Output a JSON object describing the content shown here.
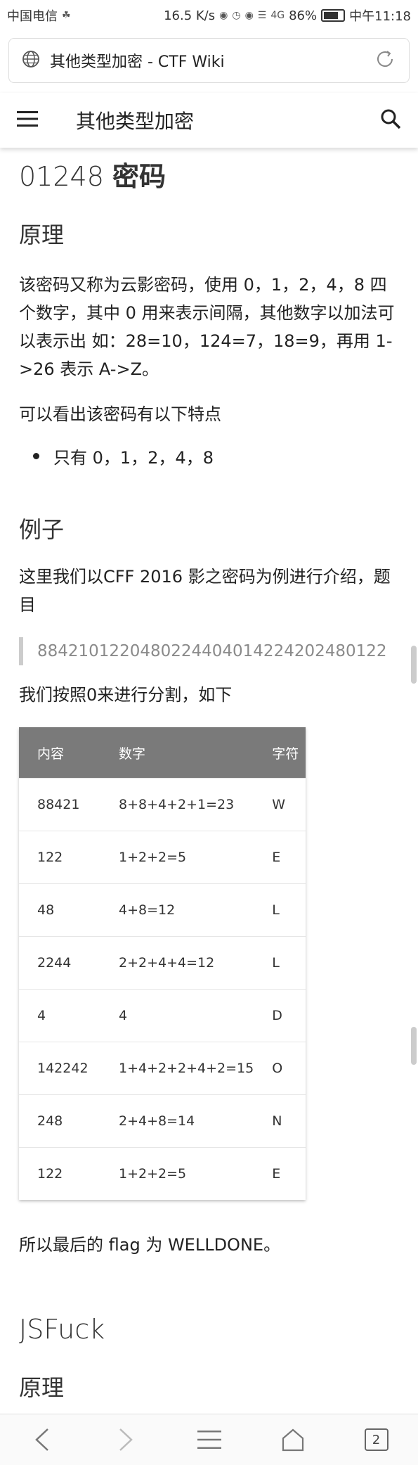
{
  "status_bar": {
    "carrier": "中国电信",
    "speed": "16.5 K/s",
    "signal_label": "4G",
    "battery": "86%",
    "time": "中午11:18"
  },
  "url_bar": {
    "title": "其他类型加密 - CTF Wiki"
  },
  "app_bar": {
    "title": "其他类型加密"
  },
  "content": {
    "section1_title_num": "01248",
    "section1_title_zh": "密码",
    "principle_heading": "原理",
    "principle_text": "该密码又称为云影密码，使用 0，1，2，4，8 四个数字，其中 0 用来表示间隔，其他数字以加法可以表示出 如：28=10，124=7，18=9，再用 1->26 表示 A->Z。",
    "features_intro": "可以看出该密码有以下特点",
    "features": [
      "只有 0，1，2，4，8"
    ],
    "example_heading": "例子",
    "example_text": "这里我们以CFF 2016 影之密码为例进行介绍，题目",
    "cipher_text": "8842101220480224404014224202480122",
    "split_text": "我们按照0来进行分割，如下",
    "table": {
      "headers": [
        "内容",
        "数字",
        "字符"
      ],
      "rows": [
        [
          "88421",
          "8+8+4+2+1=23",
          "W"
        ],
        [
          "122",
          "1+2+2=5",
          "E"
        ],
        [
          "48",
          "4+8=12",
          "L"
        ],
        [
          "2244",
          "2+2+4+4=12",
          "L"
        ],
        [
          "4",
          "4",
          "D"
        ],
        [
          "142242",
          "1+4+2+2+4+2=15",
          "O"
        ],
        [
          "248",
          "2+4+8=14",
          "N"
        ],
        [
          "122",
          "1+2+2=5",
          "E"
        ]
      ]
    },
    "conclusion": "所以最后的 flag 为 WELLDONE。",
    "section2_title": "JSFuck",
    "section2_sub": "原理"
  },
  "bottom_bar": {
    "tab_count": "2"
  }
}
